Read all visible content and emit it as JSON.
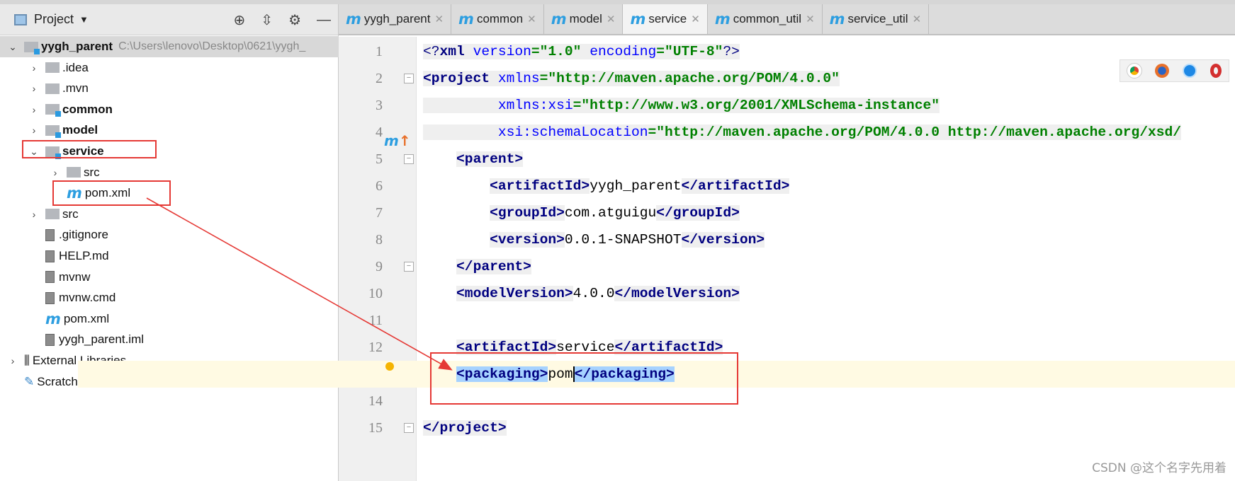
{
  "sidebar": {
    "title": "Project",
    "tools": [
      "⊕",
      "⇳",
      "⚙",
      "—"
    ],
    "items": [
      {
        "label": "yygh_parent",
        "path": "C:\\Users\\lenovo\\Desktop\\0621\\yygh_",
        "depth": 0,
        "arrow": "⌄",
        "icon": "module-folder",
        "bold": true,
        "root": true
      },
      {
        "label": ".idea",
        "depth": 1,
        "arrow": "›",
        "icon": "folder"
      },
      {
        "label": ".mvn",
        "depth": 1,
        "arrow": "›",
        "icon": "folder"
      },
      {
        "label": "common",
        "depth": 1,
        "arrow": "›",
        "icon": "module-folder",
        "bold": true
      },
      {
        "label": "model",
        "depth": 1,
        "arrow": "›",
        "icon": "module-folder",
        "bold": true
      },
      {
        "label": "service",
        "depth": 1,
        "arrow": "⌄",
        "icon": "module-folder",
        "bold": true
      },
      {
        "label": "src",
        "depth": 2,
        "arrow": "›",
        "icon": "folder"
      },
      {
        "label": "pom.xml",
        "depth": 2,
        "arrow": "",
        "icon": "maven"
      },
      {
        "label": "src",
        "depth": 1,
        "arrow": "›",
        "icon": "folder"
      },
      {
        "label": ".gitignore",
        "depth": 1,
        "arrow": "",
        "icon": "file"
      },
      {
        "label": "HELP.md",
        "depth": 1,
        "arrow": "",
        "icon": "file"
      },
      {
        "label": "mvnw",
        "depth": 1,
        "arrow": "",
        "icon": "file"
      },
      {
        "label": "mvnw.cmd",
        "depth": 1,
        "arrow": "",
        "icon": "file"
      },
      {
        "label": "pom.xml",
        "depth": 1,
        "arrow": "",
        "icon": "maven"
      },
      {
        "label": "yygh_parent.iml",
        "depth": 1,
        "arrow": "",
        "icon": "file"
      },
      {
        "label": "External Libraries",
        "depth": 0,
        "arrow": "›",
        "icon": "library"
      },
      {
        "label": "Scratches and Consoles",
        "depth": 0,
        "arrow": "",
        "icon": "scratch"
      }
    ]
  },
  "tabs": [
    {
      "label": "yygh_parent"
    },
    {
      "label": "common"
    },
    {
      "label": "model"
    },
    {
      "label": "service",
      "active": true
    },
    {
      "label": "common_util"
    },
    {
      "label": "service_util"
    }
  ],
  "editor": {
    "lines": [
      {
        "n": "1",
        "hl": true,
        "t": [
          [
            "<?",
            "br"
          ],
          [
            "xml ",
            "tag"
          ],
          [
            "version",
            "attr"
          ],
          [
            "=\"1.0\" ",
            "val"
          ],
          [
            "encoding",
            "attr"
          ],
          [
            "=\"UTF-8\"",
            "val"
          ],
          [
            "?>",
            "br"
          ]
        ]
      },
      {
        "n": "2",
        "hl": true,
        "fold": true,
        "t": [
          [
            "<project ",
            "tag"
          ],
          [
            "xmlns",
            "attr"
          ],
          [
            "=\"http://maven.apache.org/POM/4.0.0\"",
            "val"
          ]
        ]
      },
      {
        "n": "3",
        "hl": true,
        "t": [
          [
            "         ",
            "txt"
          ],
          [
            "xmlns:xsi",
            "attr"
          ],
          [
            "=\"http://www.w3.org/2001/XMLSchema-instance\"",
            "val"
          ]
        ]
      },
      {
        "n": "4",
        "hl": true,
        "t": [
          [
            "         ",
            "txt"
          ],
          [
            "xsi:schemaLocation",
            "attr"
          ],
          [
            "=\"http://maven.apache.org/POM/4.0.0 http://maven.apache.org/xsd/",
            "val"
          ]
        ]
      },
      {
        "n": "5",
        "fold": true,
        "t": [
          [
            "    ",
            "txt"
          ],
          [
            "<parent>",
            "tag"
          ]
        ]
      },
      {
        "n": "6",
        "t": [
          [
            "        ",
            "txt"
          ],
          [
            "<artifactId>",
            "tag"
          ],
          [
            "yygh_parent",
            "txt"
          ],
          [
            "</artifactId>",
            "tag"
          ]
        ]
      },
      {
        "n": "7",
        "t": [
          [
            "        ",
            "txt"
          ],
          [
            "<groupId>",
            "tag"
          ],
          [
            "com.atguigu",
            "txt"
          ],
          [
            "</groupId>",
            "tag"
          ]
        ]
      },
      {
        "n": "8",
        "t": [
          [
            "        ",
            "txt"
          ],
          [
            "<version>",
            "tag"
          ],
          [
            "0.0.1-SNAPSHOT",
            "txt"
          ],
          [
            "</version>",
            "tag"
          ]
        ]
      },
      {
        "n": "9",
        "fold": true,
        "t": [
          [
            "    ",
            "txt"
          ],
          [
            "</parent>",
            "tag"
          ]
        ]
      },
      {
        "n": "10",
        "t": [
          [
            "    ",
            "txt"
          ],
          [
            "<modelVersion>",
            "tag"
          ],
          [
            "4.0.0",
            "txt"
          ],
          [
            "</modelVersion>",
            "tag"
          ]
        ]
      },
      {
        "n": "11",
        "t": []
      },
      {
        "n": "12",
        "t": [
          [
            "    ",
            "txt"
          ],
          [
            "<artifactId>",
            "tag"
          ],
          [
            "service",
            "txt"
          ],
          [
            "</artifactId>",
            "tag"
          ]
        ]
      },
      {
        "n": "13",
        "cur": true,
        "t": [
          [
            "    ",
            "txt"
          ],
          [
            "<packaging>",
            "tag sel"
          ],
          [
            "pom",
            "txt"
          ],
          [
            "</packaging>",
            "tag sel caret"
          ]
        ]
      },
      {
        "n": "14",
        "t": []
      },
      {
        "n": "15",
        "fold": true,
        "t": [
          [
            "</project>",
            "tag"
          ]
        ]
      }
    ]
  },
  "colors": {
    "annotation": "#e53935",
    "tag": "#000080",
    "attr": "#0000ff",
    "value": "#008000",
    "selection": "#a6d2ff"
  },
  "browsers": [
    "chrome-icon",
    "firefox-icon",
    "safari-icon",
    "opera-icon"
  ],
  "watermark": "CSDN @这个名字先用着"
}
